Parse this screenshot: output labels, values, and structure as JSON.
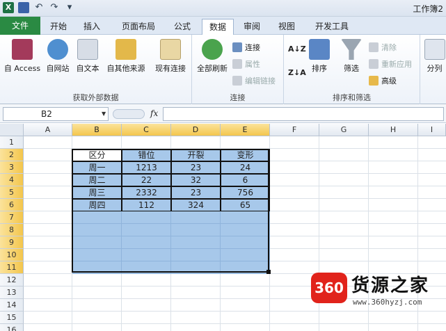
{
  "window": {
    "title": "工作簿2"
  },
  "tabs": [
    "文件",
    "开始",
    "插入",
    "页面布局",
    "公式",
    "数据",
    "审阅",
    "视图",
    "开发工具"
  ],
  "active_tab": "数据",
  "ribbon": {
    "external": {
      "label": "获取外部数据",
      "buttons": [
        "自 Access",
        "自网站",
        "自文本",
        "自其他来源",
        "现有连接"
      ]
    },
    "connections": {
      "label": "连接",
      "refresh": "全部刷新",
      "connect": "连接",
      "props": "属性",
      "edit": "编辑链接"
    },
    "sortfilter": {
      "label": "排序和筛选",
      "sort": "排序",
      "filter": "筛选",
      "clear": "清除",
      "reapply": "重新应用",
      "advanced": "高级"
    },
    "datatools": {
      "split": "分列"
    }
  },
  "formula_bar": {
    "name_box": "B2",
    "fx": "fx",
    "value": ""
  },
  "columns": [
    "A",
    "B",
    "C",
    "D",
    "E",
    "F",
    "G",
    "H",
    "I"
  ],
  "rows": [
    "1",
    "2",
    "3",
    "4",
    "5",
    "6",
    "7",
    "8",
    "9",
    "10",
    "11",
    "12",
    "13",
    "14",
    "15",
    "16"
  ],
  "table": {
    "header": [
      "区分",
      "错位",
      "开裂",
      "变形"
    ],
    "rows": [
      [
        "周一",
        "1213",
        "23",
        "24"
      ],
      [
        "周二",
        "22",
        "32",
        "6"
      ],
      [
        "周三",
        "2332",
        "23",
        "756"
      ],
      [
        "周四",
        "112",
        "324",
        "65"
      ]
    ]
  },
  "watermark": {
    "badge": "360",
    "name": "货源之家",
    "url": "www.360hyzj.com"
  },
  "colors": {
    "file_tab": "#2a8a43",
    "selection": "#a7c8ea",
    "header_highlight": "#f3c64d",
    "badge": "#e1231b"
  }
}
